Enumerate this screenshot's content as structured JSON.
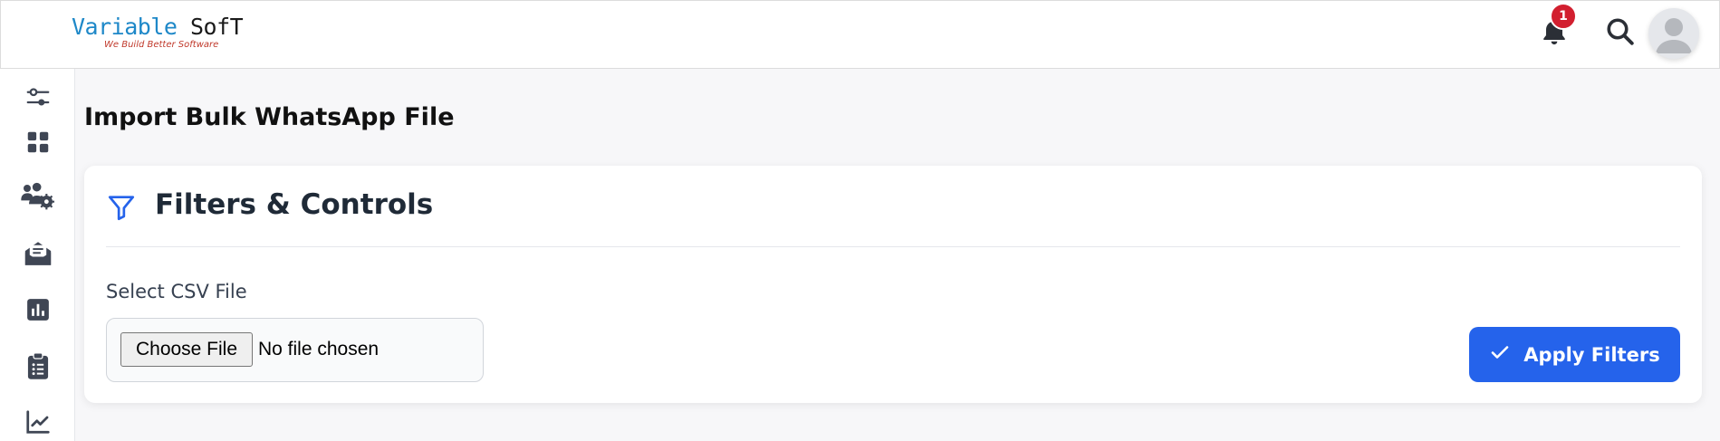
{
  "header": {
    "logo_part1": "Variable",
    "logo_part2": "SofT",
    "logo_tagline": "We Build Better Software",
    "notification_count": "1",
    "icons": [
      "bell-icon",
      "search-icon",
      "user-avatar-icon"
    ]
  },
  "sidebar": {
    "items": [
      {
        "icon": "sliders-icon"
      },
      {
        "icon": "grid-icon"
      },
      {
        "icon": "users-gear-icon"
      },
      {
        "icon": "envelope-open-icon"
      },
      {
        "icon": "bar-chart-icon"
      },
      {
        "icon": "clipboard-list-icon"
      },
      {
        "icon": "line-chart-icon"
      }
    ]
  },
  "main": {
    "page_title": "Import Bulk WhatsApp File",
    "card": {
      "title": "Filters & Controls",
      "icon": "filter-icon",
      "field_label": "Select CSV File",
      "file_button": "Choose File",
      "file_status": "No file chosen",
      "apply_button": "Apply Filters",
      "apply_icon": "check-icon"
    }
  },
  "colors": {
    "primary": "#2563eb",
    "badge": "#d21f2f",
    "logo_blue": "#1e88c8",
    "logo_tagline": "#c0392b",
    "sidebar_icon": "#3f4654",
    "background": "#f7f7f9"
  }
}
